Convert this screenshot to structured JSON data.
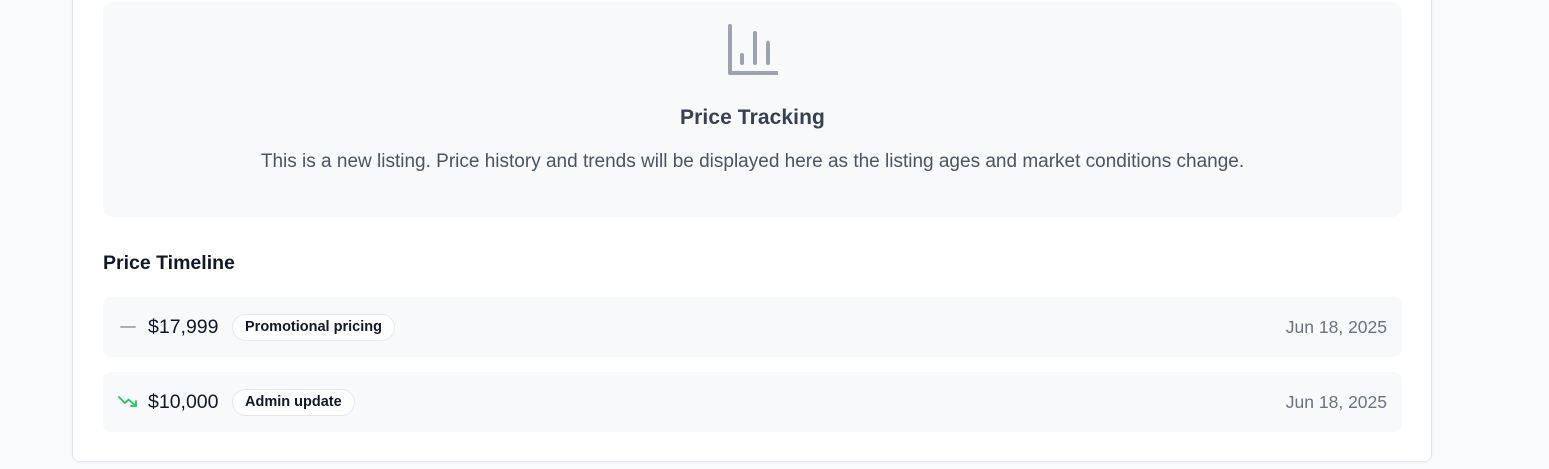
{
  "tracking": {
    "title": "Price Tracking",
    "description": "This is a new listing. Price history and trends will be displayed here as the listing ages and market conditions change.",
    "icon": "bar-chart-icon"
  },
  "timeline": {
    "heading": "Price Timeline",
    "entries": [
      {
        "trend_icon": "minus-icon",
        "trend_color": "#9ca3af",
        "price": "$17,999",
        "badge": "Promotional pricing",
        "date": "Jun 18, 2025"
      },
      {
        "trend_icon": "trending-down-icon",
        "trend_color": "#22c55e",
        "price": "$10,000",
        "badge": "Admin update",
        "date": "Jun 18, 2025"
      }
    ]
  },
  "colors": {
    "icon_gray": "#9ca3af",
    "trend_down": "#22c55e"
  }
}
